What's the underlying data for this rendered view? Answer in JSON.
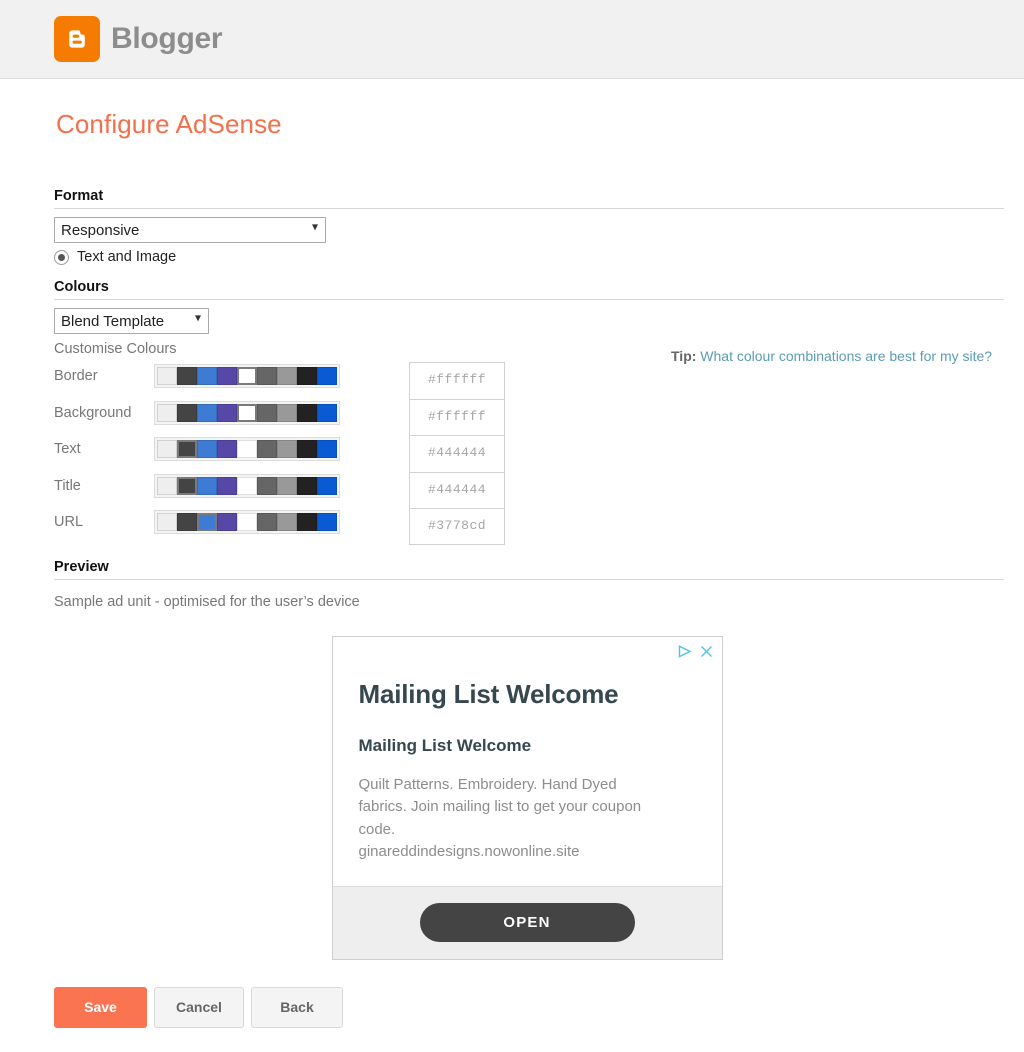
{
  "header": {
    "brand_name": "Blogger",
    "logo_icon": "blogger-logo-icon",
    "logo_color": "#f57c00"
  },
  "page": {
    "title": "Configure AdSense",
    "title_color": "#f4704a"
  },
  "format": {
    "heading": "Format",
    "select_value": "Responsive",
    "select_options": [
      "Responsive"
    ],
    "radio_label": "Text and Image",
    "radio_selected": true
  },
  "colours": {
    "heading": "Colours",
    "palette_value": "Blend Template",
    "palette_options": [
      "Blend Template"
    ],
    "customise_label": "Customise Colours",
    "swatch_palette": [
      "#eeeeee",
      "#444444",
      "#3d7bd4",
      "#5747a6",
      "#ffffff",
      "#666666",
      "#999999",
      "#222222",
      "#0a5bd3"
    ],
    "rows": [
      {
        "label": "Border",
        "hex": "#ffffff",
        "selected_index": 4
      },
      {
        "label": "Background",
        "hex": "#ffffff",
        "selected_index": 4
      },
      {
        "label": "Text",
        "hex": "#444444",
        "selected_index": 1
      },
      {
        "label": "Title",
        "hex": "#444444",
        "selected_index": 1
      },
      {
        "label": "URL",
        "hex": "#3778cd",
        "selected_index": 2
      }
    ],
    "tip_label": "Tip:",
    "tip_link": "What colour combinations are best for my site?",
    "tip_link_color": "#5b9cb5"
  },
  "preview": {
    "heading": "Preview",
    "caption": "Sample ad unit - optimised for the user’s device",
    "ad": {
      "adchoices_icon": "adchoices-triangle-icon",
      "close_icon": "close-icon",
      "badge_color": "#4fc3e8",
      "headline": "Mailing List Welcome",
      "subhead": "Mailing List Welcome",
      "body": "Quilt Patterns. Embroidery. Hand Dyed fabrics. Join mailing list to get your coupon code.",
      "url": "ginareddindesigns.nowonline.site",
      "cta_label": "OPEN",
      "cta_color": "#444444"
    }
  },
  "actions": {
    "save_label": "Save",
    "cancel_label": "Cancel",
    "back_label": "Back",
    "save_color": "#fb7452"
  }
}
